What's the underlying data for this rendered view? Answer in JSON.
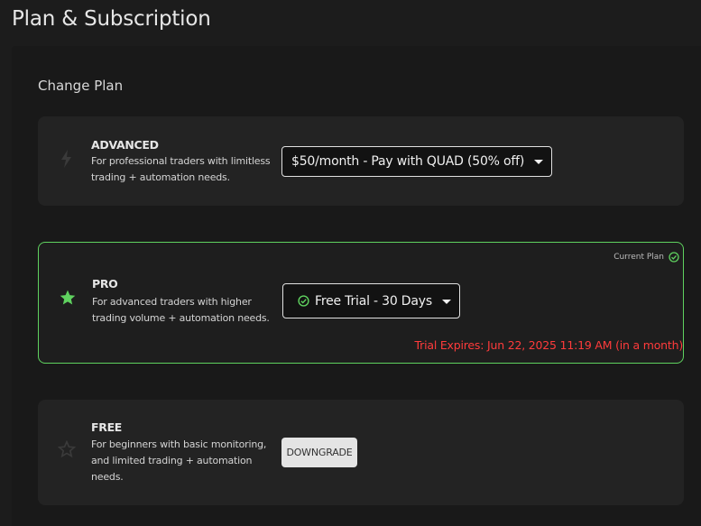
{
  "page": {
    "title": "Plan & Subscription"
  },
  "section": {
    "title": "Change Plan"
  },
  "plans": {
    "advanced": {
      "icon": "lightning-icon",
      "name": "ADVANCED",
      "description": "For professional traders with limitless trading + automation needs.",
      "select_value": "$50/month - Pay with QUAD (50% off)"
    },
    "pro": {
      "icon": "star-icon",
      "name": "PRO",
      "description": "For advanced traders with higher trading volume + automation needs.",
      "select_value": "Free Trial - 30 Days",
      "current_plan_label": "Current Plan",
      "trial_expires": "Trial Expires: Jun 22, 2025 11:19 AM (in a month)",
      "accent_color": "#5fd25f"
    },
    "free": {
      "icon": "star-outline-icon",
      "name": "FREE",
      "description": "For beginners with basic monitoring, and limited trading + automation needs.",
      "button_label": "DOWNGRADE"
    }
  },
  "colors": {
    "accent_green": "#5fd25f",
    "warning_red": "#ff3b3b"
  }
}
